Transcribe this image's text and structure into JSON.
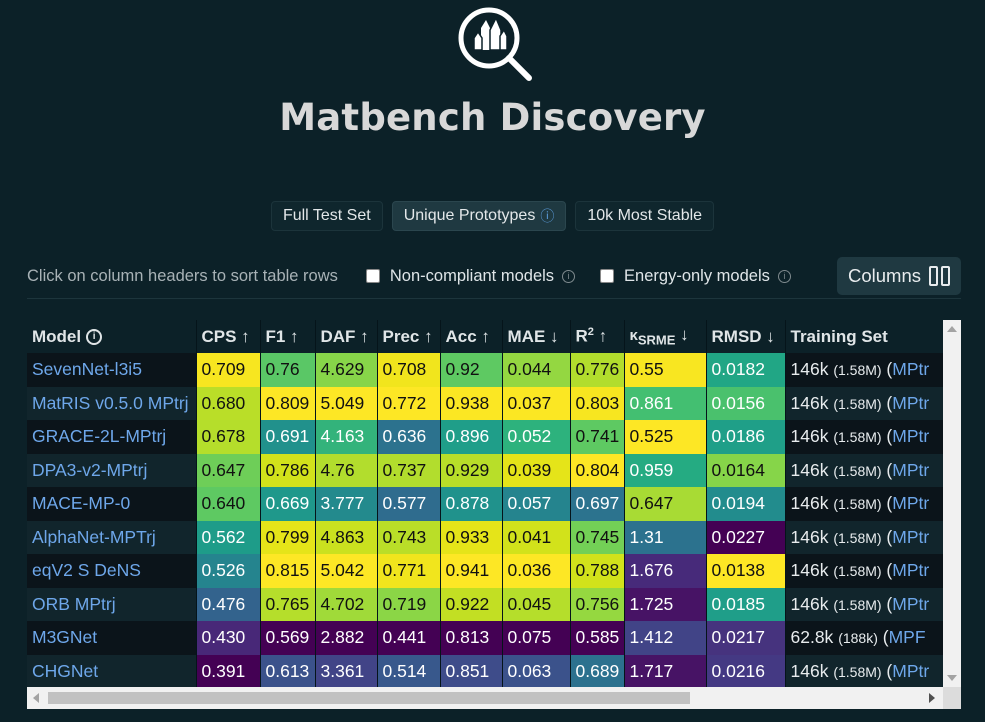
{
  "app": {
    "title": "Matbench Discovery",
    "logo_icon": "crystal-magnifier-icon"
  },
  "tabs": [
    {
      "label": "Full Test Set",
      "active": false
    },
    {
      "label": "Unique Prototypes",
      "active": true,
      "icon": "info-icon"
    },
    {
      "label": "10k Most Stable",
      "active": false
    }
  ],
  "controls": {
    "hint": "Click on column headers to sort table rows",
    "noncompliant_label": "Non-compliant models",
    "noncompliant_checked": false,
    "energy_only_label": "Energy-only models",
    "energy_only_checked": false,
    "columns_button": "Columns"
  },
  "table": {
    "headers": {
      "model": "Model",
      "cps": "CPS ↑",
      "f1": "F1 ↑",
      "daf": "DAF ↑",
      "prec": "Prec ↑",
      "acc": "Acc ↑",
      "mae": "MAE ↓",
      "r2": "R",
      "r2_sup": "2",
      "r2_arrow": " ↑",
      "kappa": "κ",
      "kappa_sub": "SRME",
      "kappa_arrow": " ↓",
      "rmsd": "RMSD ↓",
      "training": "Training Set"
    },
    "rows": [
      {
        "model": "SevenNet-l3i5",
        "cps": "0.709",
        "f1": "0.76",
        "daf": "4.629",
        "prec": "0.708",
        "acc": "0.92",
        "mae": "0.044",
        "r2": "0.776",
        "kappa": "0.55",
        "rmsd": "0.0182",
        "train": "146k",
        "train_small": "(1.58M)",
        "train_link": "MPtr"
      },
      {
        "model": "MatRIS v0.5.0 MPtrj",
        "cps": "0.680",
        "f1": "0.809",
        "daf": "5.049",
        "prec": "0.772",
        "acc": "0.938",
        "mae": "0.037",
        "r2": "0.803",
        "kappa": "0.861",
        "rmsd": "0.0156",
        "train": "146k",
        "train_small": "(1.58M)",
        "train_link": "MPtr"
      },
      {
        "model": "GRACE-2L-MPtrj",
        "cps": "0.678",
        "f1": "0.691",
        "daf": "4.163",
        "prec": "0.636",
        "acc": "0.896",
        "mae": "0.052",
        "r2": "0.741",
        "kappa": "0.525",
        "rmsd": "0.0186",
        "train": "146k",
        "train_small": "(1.58M)",
        "train_link": "MPtr"
      },
      {
        "model": "DPA3-v2-MPtrj",
        "cps": "0.647",
        "f1": "0.786",
        "daf": "4.76",
        "prec": "0.737",
        "acc": "0.929",
        "mae": "0.039",
        "r2": "0.804",
        "kappa": "0.959",
        "rmsd": "0.0164",
        "train": "146k",
        "train_small": "(1.58M)",
        "train_link": "MPtr"
      },
      {
        "model": "MACE-MP-0",
        "cps": "0.640",
        "f1": "0.669",
        "daf": "3.777",
        "prec": "0.577",
        "acc": "0.878",
        "mae": "0.057",
        "r2": "0.697",
        "kappa": "0.647",
        "rmsd": "0.0194",
        "train": "146k",
        "train_small": "(1.58M)",
        "train_link": "MPtr"
      },
      {
        "model": "AlphaNet-MPTrj",
        "cps": "0.562",
        "f1": "0.799",
        "daf": "4.863",
        "prec": "0.743",
        "acc": "0.933",
        "mae": "0.041",
        "r2": "0.745",
        "kappa": "1.31",
        "rmsd": "0.0227",
        "train": "146k",
        "train_small": "(1.58M)",
        "train_link": "MPtr"
      },
      {
        "model": "eqV2 S DeNS",
        "cps": "0.526",
        "f1": "0.815",
        "daf": "5.042",
        "prec": "0.771",
        "acc": "0.941",
        "mae": "0.036",
        "r2": "0.788",
        "kappa": "1.676",
        "rmsd": "0.0138",
        "train": "146k",
        "train_small": "(1.58M)",
        "train_link": "MPtr"
      },
      {
        "model": "ORB MPtrj",
        "cps": "0.476",
        "f1": "0.765",
        "daf": "4.702",
        "prec": "0.719",
        "acc": "0.922",
        "mae": "0.045",
        "r2": "0.756",
        "kappa": "1.725",
        "rmsd": "0.0185",
        "train": "146k",
        "train_small": "(1.58M)",
        "train_link": "MPtr"
      },
      {
        "model": "M3GNet",
        "cps": "0.430",
        "f1": "0.569",
        "daf": "2.882",
        "prec": "0.441",
        "acc": "0.813",
        "mae": "0.075",
        "r2": "0.585",
        "kappa": "1.412",
        "rmsd": "0.0217",
        "train": "62.8k",
        "train_small": "(188k)",
        "train_link": "MPF"
      },
      {
        "model": "CHGNet",
        "cps": "0.391",
        "f1": "0.613",
        "daf": "3.361",
        "prec": "0.514",
        "acc": "0.851",
        "mae": "0.063",
        "r2": "0.689",
        "kappa": "1.717",
        "rmsd": "0.0216",
        "train": "146k",
        "train_small": "(1.58M)",
        "train_link": "MPtr"
      }
    ],
    "colors": [
      [
        "#f7e620",
        "#5ac766",
        "#87d549",
        "#f1e51d",
        "#5ec962",
        "#94d741",
        "#b2dd2d",
        "#f8e621",
        "#21a685"
      ],
      [
        "#bade28",
        "#fde725",
        "#fde725",
        "#fde725",
        "#fbe723",
        "#fbe723",
        "#f7e620",
        "#43bf71",
        "#4ac16d"
      ],
      [
        "#b5de2b",
        "#21918c",
        "#33b37b",
        "#2c728e",
        "#1f9e89",
        "#2db27d",
        "#5ec962",
        "#fde725",
        "#1f9f88"
      ],
      [
        "#6ece58",
        "#d2e21b",
        "#b2dd2d",
        "#b2dd2d",
        "#b8de29",
        "#e5e419",
        "#fde725",
        "#25ab82",
        "#86d549"
      ],
      [
        "#5ec962",
        "#1f988b",
        "#238a8d",
        "#2f6c8e",
        "#20928c",
        "#25848e",
        "#2c738e",
        "#a8db34",
        "#228c8d"
      ],
      [
        "#1e9c89",
        "#e5e419",
        "#cae11f",
        "#bade28",
        "#e5e419",
        "#d2e21b",
        "#73d056",
        "#2c728e",
        "#440154"
      ],
      [
        "#25848e",
        "#fde725",
        "#fde725",
        "#f1e51d",
        "#fde725",
        "#fde725",
        "#d2e21b",
        "#472a7a",
        "#fde725"
      ],
      [
        "#33638d",
        "#b5de2b",
        "#a0da39",
        "#8bd646",
        "#c2df23",
        "#b5de2b",
        "#95d840",
        "#471365",
        "#1f9e89"
      ],
      [
        "#482878",
        "#440154",
        "#440154",
        "#440154",
        "#440154",
        "#440154",
        "#440154",
        "#414487",
        "#46337e"
      ],
      [
        "#440154",
        "#3b528b",
        "#414487",
        "#38588c",
        "#3e4c8a",
        "#3b528b",
        "#2c718e",
        "#471365",
        "#443983"
      ]
    ]
  }
}
